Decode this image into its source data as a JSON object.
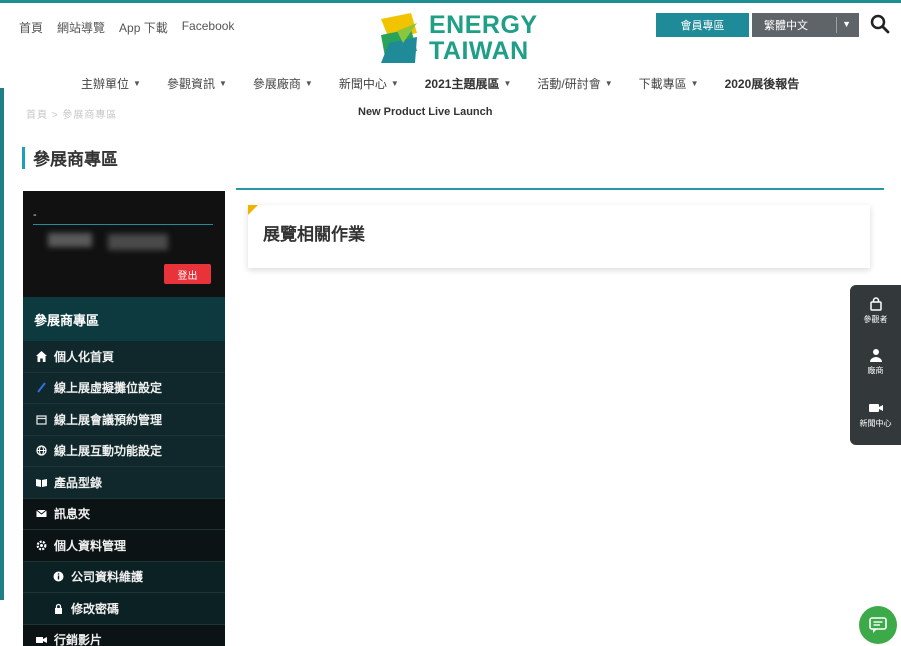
{
  "top_links": [
    "首頁",
    "網站導覽",
    "App 下載",
    "Facebook"
  ],
  "logo": {
    "line1": "ENERGY",
    "line2": "TAIWAN"
  },
  "header": {
    "member_button": "會員專區",
    "language": "繁體中文"
  },
  "main_nav": [
    {
      "label": "主辦單位",
      "dropdown": true
    },
    {
      "label": "參觀資訊",
      "dropdown": true
    },
    {
      "label": "參展廠商",
      "dropdown": true
    },
    {
      "label": "新聞中心",
      "dropdown": true
    },
    {
      "label": "2021主題展區",
      "dropdown": true
    },
    {
      "label": "活動/研討會",
      "dropdown": true
    },
    {
      "label": "下載專區",
      "dropdown": true
    },
    {
      "label": "2020展後報告",
      "dropdown": false
    }
  ],
  "breadcrumb": "首頁 > 參展商專區",
  "live_launch": "New Product Live Launch",
  "page_title": "參展商專區",
  "sidebar": {
    "dash": "-",
    "logout": "登出",
    "heading": "參展商專區",
    "items": [
      {
        "label": "個人化首頁",
        "icon": "home-icon"
      },
      {
        "label": "線上展虛擬攤位設定",
        "icon": "pencil-icon"
      },
      {
        "label": "線上展會議預約管理",
        "icon": "calendar-icon"
      },
      {
        "label": "線上展互動功能設定",
        "icon": "globe-icon"
      },
      {
        "label": "產品型錄",
        "icon": "book-icon"
      },
      {
        "label": "訊息夾",
        "icon": "envelope-icon"
      },
      {
        "label": "個人資料管理",
        "icon": "gear-icon"
      },
      {
        "label": "公司資料維護",
        "icon": "info-icon"
      },
      {
        "label": "修改密碼",
        "icon": "lock-icon"
      },
      {
        "label": "行銷影片",
        "icon": "video-icon"
      }
    ]
  },
  "card_title": "展覽相關作業",
  "float_bar": {
    "visitor": "參觀者",
    "exhibitor": "廠商",
    "news": "新聞中心"
  },
  "colors": {
    "teal": "#1f8a98",
    "logout_red": "#e8333b",
    "chat_green": "#3daa4a"
  }
}
